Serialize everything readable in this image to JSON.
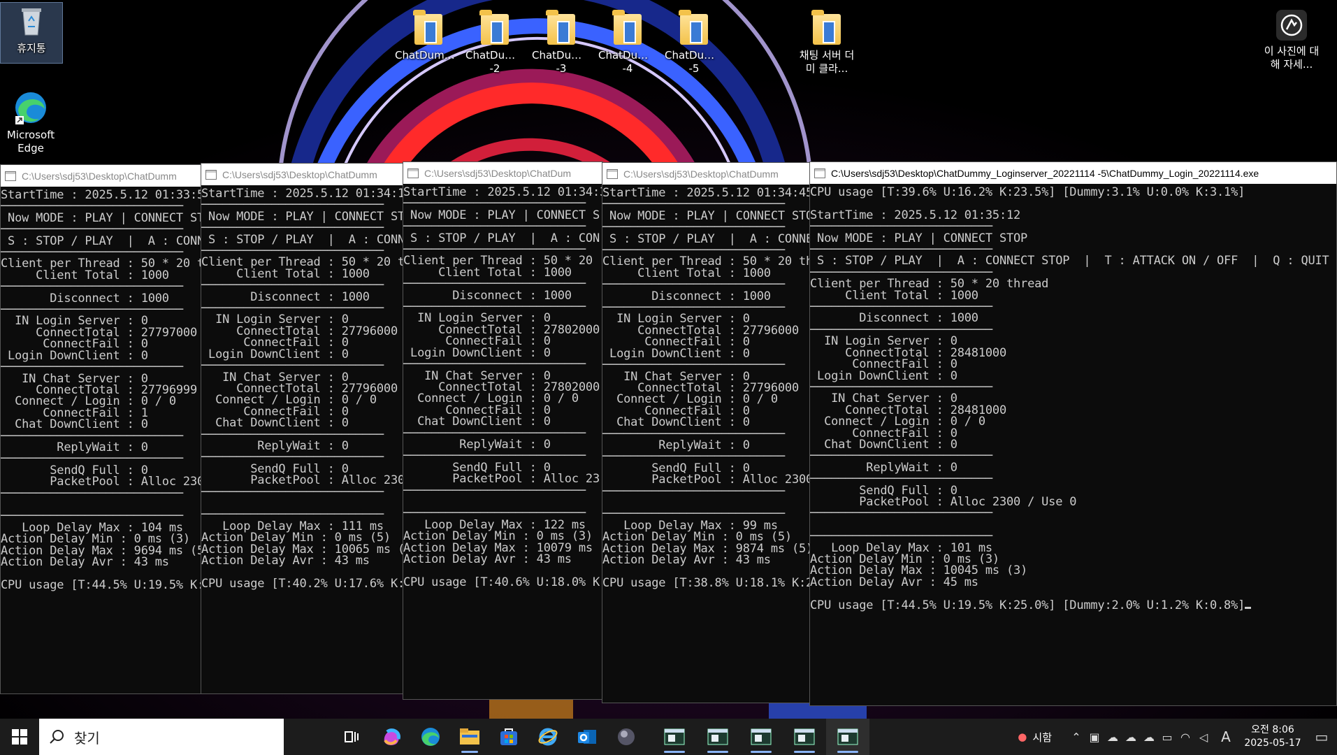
{
  "desktop": {
    "icons": [
      {
        "label": "휴지통",
        "icon": "recycle-bin-icon"
      },
      {
        "label": "Microsoft Edge",
        "icon": "edge-icon"
      },
      {
        "label": "ChatDumm...",
        "icon": "folder-icon"
      },
      {
        "label": "ChatDumm... -2",
        "icon": "folder-icon"
      },
      {
        "label": "ChatDumm... -3",
        "icon": "folder-icon"
      },
      {
        "label": "ChatDumm... -4",
        "icon": "folder-icon"
      },
      {
        "label": "ChatDumm... -5",
        "icon": "folder-icon"
      },
      {
        "label": "채팅 서버 더미 클라...",
        "icon": "folder-icon"
      },
      {
        "label": "이 사진에 대해 자세...",
        "icon": "learn-about-picture-icon"
      }
    ]
  },
  "consoles": [
    {
      "title": "C:\\Users\\sdj53\\Desktop\\ChatDumm",
      "text": "StartTime : 2025.5.12 01:33:5\n──────────────────────────\n Now MODE : PLAY | CONNECT ST\n──────────────────────────\n S : STOP / PLAY  |  A : CONN\n──────────────────────────\nClient per Thread : 50 * 20 t\n     Client Total : 1000\n──────────────────────────\n       Disconnect : 1000\n──────────────────────────\n  IN Login Server : 0\n     ConnectTotal : 27797000\n      ConnectFail : 0\n Login DownClient : 0\n──────────────────────────\n   IN Chat Server : 0\n     ConnectTotal : 27796999\n  Connect / Login : 0 / 0\n      ConnectFail : 1\n  Chat DownClient : 0\n──────────────────────────\n        ReplyWait : 0\n──────────────────────────\n       SendQ Full : 0\n       PacketPool : Alloc 230\n──────────────────────────\n\n──────────────────────────\n   Loop Delay Max : 104 ms\nAction Delay Min : 0 ms (3)\nAction Delay Max : 9694 ms (5\nAction Delay Avr : 43 ms\n\nCPU usage [T:44.5% U:19.5% K:"
    },
    {
      "title": "C:\\Users\\sdj53\\Desktop\\ChatDumm",
      "text": "StartTime : 2025.5.12 01:34:1\n──────────────────────────\n Now MODE : PLAY | CONNECT ST\n──────────────────────────\n S : STOP / PLAY  |  A : CONN\n──────────────────────────\nClient per Thread : 50 * 20 t\n     Client Total : 1000\n──────────────────────────\n       Disconnect : 1000\n──────────────────────────\n  IN Login Server : 0\n     ConnectTotal : 27796000\n      ConnectFail : 0\n Login DownClient : 0\n──────────────────────────\n   IN Chat Server : 0\n     ConnectTotal : 27796000\n  Connect / Login : 0 / 0\n      ConnectFail : 0\n  Chat DownClient : 0\n──────────────────────────\n        ReplyWait : 0\n──────────────────────────\n       SendQ Full : 0\n       PacketPool : Alloc 230\n──────────────────────────\n\n──────────────────────────\n   Loop Delay Max : 111 ms\nAction Delay Min : 0 ms (5)\nAction Delay Max : 10065 ms (\nAction Delay Avr : 43 ms\n\nCPU usage [T:40.2% U:17.6% K:"
    },
    {
      "title": "C:\\Users\\sdj53\\Desktop\\ChatDum",
      "text": "StartTime : 2025.5.12 01:34:3\n──────────────────────────\n Now MODE : PLAY | CONNECT S\n──────────────────────────\n S : STOP / PLAY  |  A : CON\n──────────────────────────\nClient per Thread : 50 * 20\n     Client Total : 1000\n──────────────────────────\n       Disconnect : 1000\n──────────────────────────\n  IN Login Server : 0\n     ConnectTotal : 27802000\n      ConnectFail : 0\n Login DownClient : 0\n──────────────────────────\n   IN Chat Server : 0\n     ConnectTotal : 27802000\n  Connect / Login : 0 / 0\n      ConnectFail : 0\n  Chat DownClient : 0\n──────────────────────────\n        ReplyWait : 0\n──────────────────────────\n       SendQ Full : 0\n       PacketPool : Alloc 23\n──────────────────────────\n\n──────────────────────────\n   Loop Delay Max : 122 ms\nAction Delay Min : 0 ms (3)\nAction Delay Max : 10079 ms\nAction Delay Avr : 43 ms\n\nCPU usage [T:40.6% U:18.0% K"
    },
    {
      "title": "C:\\Users\\sdj53\\Desktop\\ChatDumm",
      "text": "StartTime : 2025.5.12 01:34:45\n──────────────────────────\n Now MODE : PLAY | CONNECT STO\n──────────────────────────\n S : STOP / PLAY  |  A : CONNE\n──────────────────────────\nClient per Thread : 50 * 20 th\n     Client Total : 1000\n──────────────────────────\n       Disconnect : 1000\n──────────────────────────\n  IN Login Server : 0\n     ConnectTotal : 27796000\n      ConnectFail : 0\n Login DownClient : 0\n──────────────────────────\n   IN Chat Server : 0\n     ConnectTotal : 27796000\n  Connect / Login : 0 / 0\n      ConnectFail : 0\n  Chat DownClient : 0\n──────────────────────────\n        ReplyWait : 0\n──────────────────────────\n       SendQ Full : 0\n       PacketPool : Alloc 2300\n──────────────────────────\n\n──────────────────────────\n   Loop Delay Max : 99 ms\nAction Delay Min : 0 ms (5)\nAction Delay Max : 9874 ms (5)\nAction Delay Avr : 43 ms\n\nCPU usage [T:38.8% U:18.1% K:2"
    },
    {
      "title": "C:\\Users\\sdj53\\Desktop\\ChatDummy_Loginserver_20221114 -5\\ChatDummy_Login_20221114.exe",
      "text": "CPU usage [T:39.6% U:16.2% K:23.5%] [Dummy:3.1% U:0.0% K:3.1%]\n\nStartTime : 2025.5.12 01:35:12\n──────────────────────────\n Now MODE : PLAY | CONNECT STOP\n──────────────────────────\n S : STOP / PLAY  |  A : CONNECT STOP  |  T : ATTACK ON / OFF  |  Q : QUIT\n──────────────────────────\nClient per Thread : 50 * 20 thread\n     Client Total : 1000\n──────────────────────────\n       Disconnect : 1000\n──────────────────────────\n  IN Login Server : 0\n     ConnectTotal : 28481000\n      ConnectFail : 0\n Login DownClient : 0\n──────────────────────────\n   IN Chat Server : 0\n     ConnectTotal : 28481000\n  Connect / Login : 0 / 0\n      ConnectFail : 0\n  Chat DownClient : 0\n──────────────────────────\n        ReplyWait : 0\n──────────────────────────\n       SendQ Full : 0\n       PacketPool : Alloc 2300 / Use 0\n──────────────────────────\n\n──────────────────────────\n   Loop Delay Max : 101 ms\nAction Delay Min : 0 ms (3)\nAction Delay Max : 10045 ms (3)\nAction Delay Avr : 45 ms\n\nCPU usage [T:44.5% U:19.5% K:25.0%] [Dummy:2.0% U:1.2% K:0.8%]"
    }
  ],
  "taskbar": {
    "search_placeholder": "찾기",
    "apps": [
      "task-view-icon",
      "copilot-icon",
      "edge-icon",
      "file-explorer-icon",
      "store-icon",
      "internet-explorer-icon",
      "outlook-icon",
      "media-icon",
      "console-icon",
      "console-icon",
      "console-icon",
      "console-icon",
      "console-icon"
    ],
    "tray_label": "시함",
    "ime": "A",
    "time": "오전 8:06",
    "date": "2025-05-17"
  }
}
